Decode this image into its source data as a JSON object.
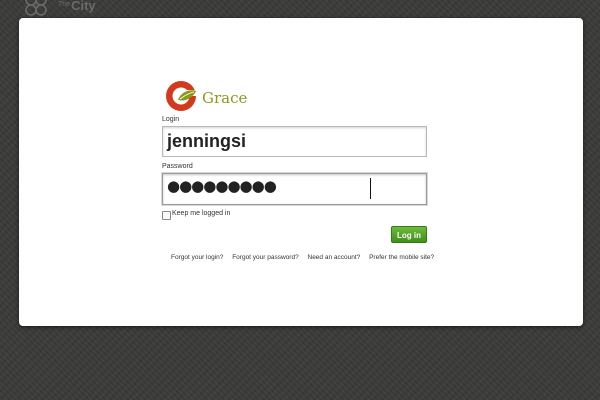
{
  "header": {
    "brand_the": "The",
    "brand_name": "City"
  },
  "login_card": {
    "logo_text": "Grace",
    "login_label": "Login",
    "login_value": "jenningsi",
    "password_label": "Password",
    "password_masked": "●●●●●●●●●",
    "remember_label": "Keep me logged in",
    "remember_checked": false,
    "submit_label": "Log in",
    "links": {
      "forgot_login": "Forgot your login?",
      "forgot_password": "Forgot your password?",
      "need_account": "Need an account?",
      "mobile_site": "Prefer the mobile site?"
    }
  },
  "colors": {
    "background": "#3a3a38",
    "accent_green": "#4fa125",
    "brand_olive": "#8c9a1c",
    "brand_red": "#d23a1c"
  },
  "icons": {
    "city_logo": "city-flower-logo-icon",
    "grace_logo": "grace-leaf-logo-icon"
  }
}
